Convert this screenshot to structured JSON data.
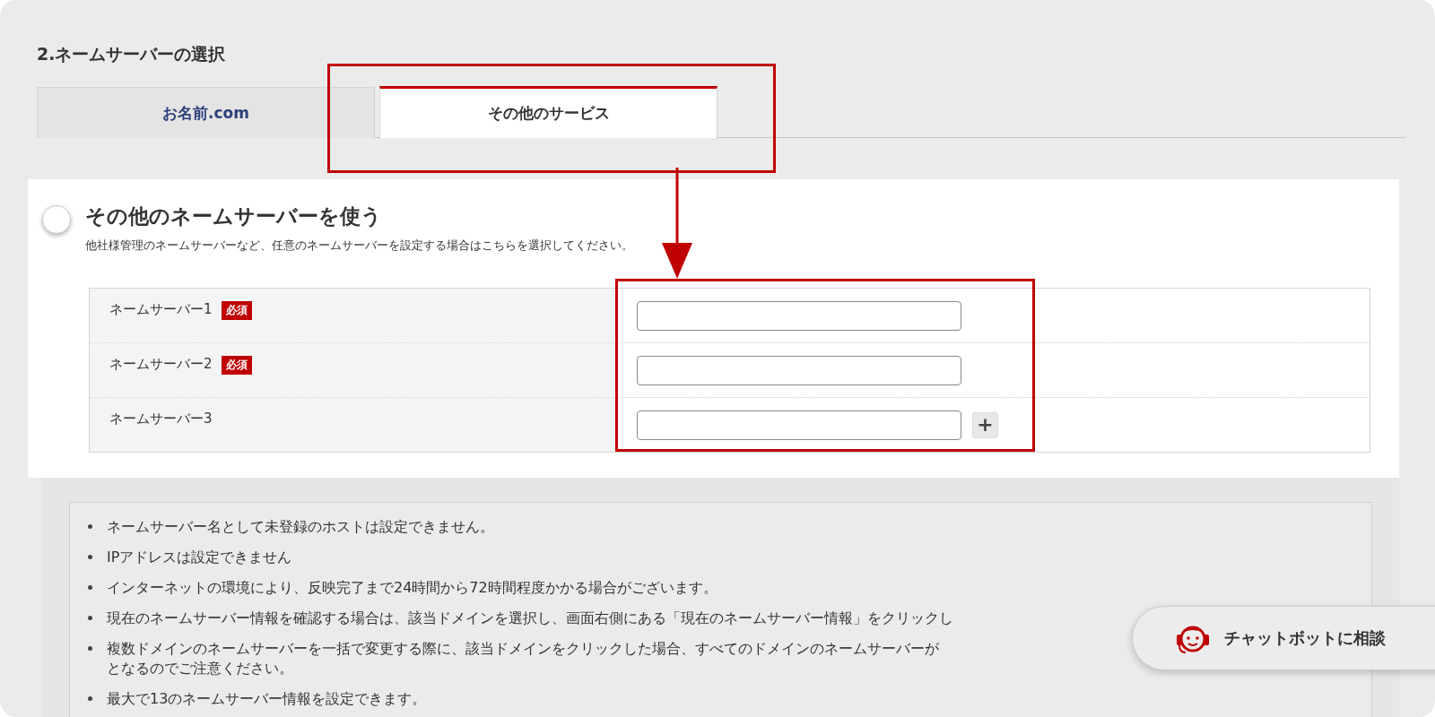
{
  "section_title": "2.ネームサーバーの選択",
  "tabs": [
    {
      "label": "お名前.com",
      "selected": false
    },
    {
      "label": "その他のサービス",
      "selected": true
    }
  ],
  "option": {
    "title": "その他のネームサーバーを使う",
    "selected": false,
    "description": "他社様管理のネームサーバーなど、任意のネームサーバーを設定する場合はこちらを選択してください。"
  },
  "nameservers": [
    {
      "label": "ネームサーバー1",
      "required": true,
      "badge": "必須",
      "add_button": false
    },
    {
      "label": "ネームサーバー2",
      "required": true,
      "badge": "必須",
      "add_button": false
    },
    {
      "label": "ネームサーバー3",
      "required": false,
      "add_button": true
    }
  ],
  "add_button_label": "+",
  "notes": [
    {
      "text": "ネームサーバー名として未登録のホストは設定できません。"
    },
    {
      "text": "IPアドレスは設定できません"
    },
    {
      "text": "インターネットの環境により、反映完了まで24時間から72時間程度かかる場合がございます。"
    },
    {
      "text": "現在のネームサーバー情報を確認する場合は、該当ドメインを選択し、画面右側にある「現在のネームサーバー情報」をクリックし"
    },
    {
      "text": "複数ドメインのネームサーバーを一括で変更する際に、該当ドメインをクリックした場合、すべてのドメインのネームサーバーが",
      "continuation": "となるのでご注意ください。"
    },
    {
      "text": "最大で13のネームサーバー情報を設定できます。"
    }
  ],
  "chatbot": {
    "label": "チャットボットに相談"
  }
}
